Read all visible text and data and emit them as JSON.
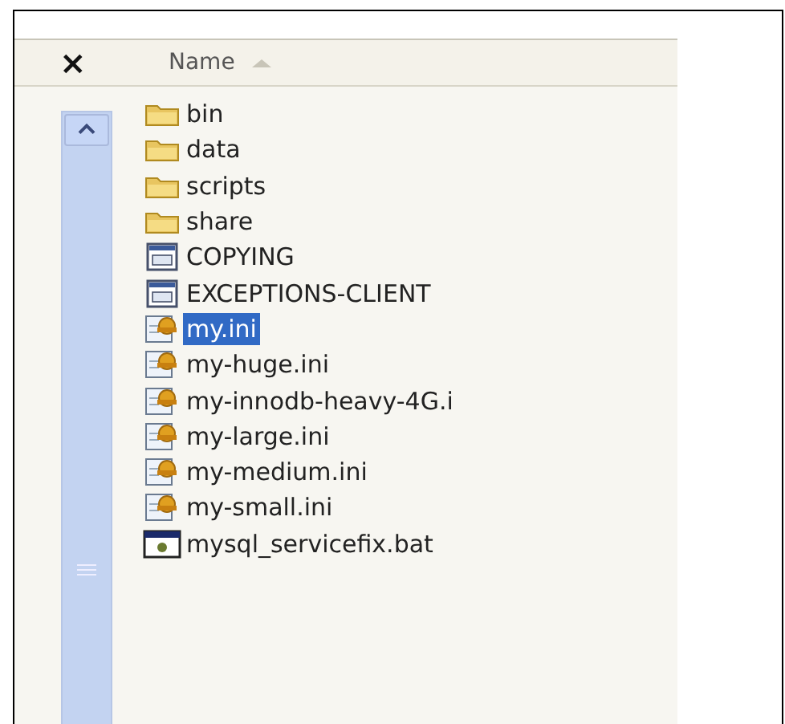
{
  "header": {
    "close": "×",
    "column": "Name",
    "sorted_ascending": true
  },
  "files": [
    {
      "name": "bin",
      "kind": "folder",
      "selected": false
    },
    {
      "name": "data",
      "kind": "folder",
      "selected": false
    },
    {
      "name": "scripts",
      "kind": "folder",
      "selected": false
    },
    {
      "name": "share",
      "kind": "folder",
      "selected": false
    },
    {
      "name": "COPYING",
      "kind": "document",
      "selected": false
    },
    {
      "name": "EXCEPTIONS-CLIENT",
      "kind": "document",
      "selected": false
    },
    {
      "name": "my.ini",
      "kind": "config",
      "selected": true
    },
    {
      "name": "my-huge.ini",
      "kind": "config",
      "selected": false
    },
    {
      "name": "my-innodb-heavy-4G.i",
      "kind": "config",
      "selected": false
    },
    {
      "name": "my-large.ini",
      "kind": "config",
      "selected": false
    },
    {
      "name": "my-medium.ini",
      "kind": "config",
      "selected": false
    },
    {
      "name": "my-small.ini",
      "kind": "config",
      "selected": false
    },
    {
      "name": "mysql_servicefix.bat",
      "kind": "batch",
      "selected": false
    }
  ]
}
